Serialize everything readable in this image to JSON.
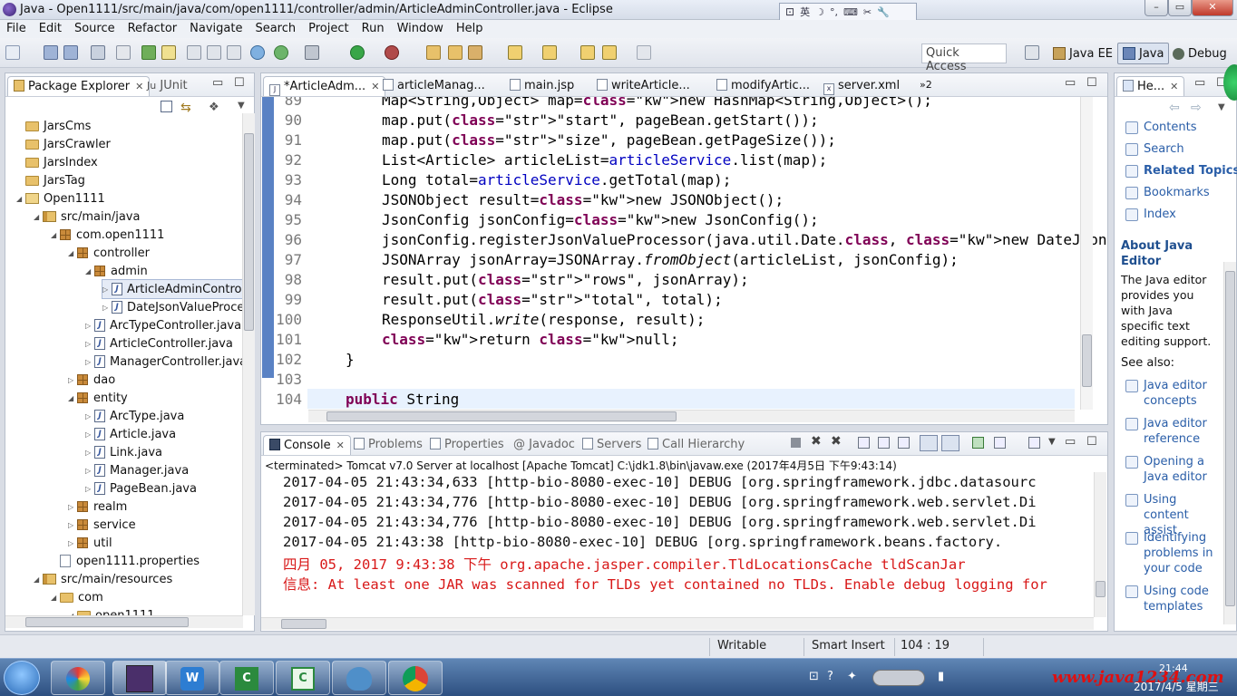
{
  "window": {
    "title": "Java - Open1111/src/main/java/com/open1111/controller/admin/ArticleAdminController.java - Eclipse",
    "ime_label": "英"
  },
  "menu": [
    "File",
    "Edit",
    "Source",
    "Refactor",
    "Navigate",
    "Search",
    "Project",
    "Run",
    "Window",
    "Help"
  ],
  "toolbar": {
    "quick_access": "Quick Access",
    "perspectives": [
      "Java EE",
      "Java",
      "Debug"
    ]
  },
  "package_explorer": {
    "tabs": [
      "Package Explorer",
      "JUnit"
    ],
    "items": [
      {
        "label": "JarsCms",
        "kind": "project"
      },
      {
        "label": "JarsCrawler",
        "kind": "project"
      },
      {
        "label": "JarsIndex",
        "kind": "project"
      },
      {
        "label": "JarsTag",
        "kind": "project"
      },
      {
        "label": "Open1111",
        "kind": "project"
      },
      {
        "label": "src/main/java",
        "kind": "source"
      },
      {
        "label": "com.open1111",
        "kind": "package"
      },
      {
        "label": "controller",
        "kind": "package"
      },
      {
        "label": "admin",
        "kind": "package"
      },
      {
        "label": "ArticleAdminControll",
        "kind": "java"
      },
      {
        "label": "DateJsonValueProce",
        "kind": "java"
      },
      {
        "label": "ArcTypeController.java",
        "kind": "java"
      },
      {
        "label": "ArticleController.java",
        "kind": "java"
      },
      {
        "label": "ManagerController.java",
        "kind": "java"
      },
      {
        "label": "dao",
        "kind": "package"
      },
      {
        "label": "entity",
        "kind": "package"
      },
      {
        "label": "ArcType.java",
        "kind": "java"
      },
      {
        "label": "Article.java",
        "kind": "java"
      },
      {
        "label": "Link.java",
        "kind": "java"
      },
      {
        "label": "Manager.java",
        "kind": "java"
      },
      {
        "label": "PageBean.java",
        "kind": "java"
      },
      {
        "label": "realm",
        "kind": "package"
      },
      {
        "label": "service",
        "kind": "package"
      },
      {
        "label": "util",
        "kind": "package"
      },
      {
        "label": "open1111.properties",
        "kind": "file"
      },
      {
        "label": "src/main/resources",
        "kind": "source"
      },
      {
        "label": "com",
        "kind": "folder"
      },
      {
        "label": "open1111",
        "kind": "folder"
      }
    ]
  },
  "editor": {
    "tabs": [
      "*ArticleAdm...",
      "articleManag...",
      "main.jsp",
      "writeArticle...",
      "modifyArtic...",
      "server.xml",
      "»2"
    ],
    "line_numbers": [
      "89",
      "90",
      "91",
      "92",
      "93",
      "94",
      "95",
      "96",
      "97",
      "98",
      "99",
      "100",
      "101",
      "102",
      "103",
      "104"
    ],
    "lines": [
      "Map<String,Object> map=new HashMap<String,Object>();",
      "map.put(\"start\", pageBean.getStart());",
      "map.put(\"size\", pageBean.getPageSize());",
      "List<Article> articleList=articleService.list(map);",
      "Long total=articleService.getTotal(map);",
      "JSONObject result=new JSONObject();",
      "JsonConfig jsonConfig=new JsonConfig();",
      "jsonConfig.registerJsonValueProcessor(java.util.Date.class, new DateJsonValue",
      "JSONArray jsonArray=JSONArray.fromObject(articleList, jsonConfig);",
      "result.put(\"rows\", jsonArray);",
      "result.put(\"total\", total);",
      "ResponseUtil.write(response, result);",
      "return null;",
      "}",
      "",
      "public String"
    ]
  },
  "console": {
    "tabs": [
      "Console",
      "Problems",
      "Properties",
      "Javadoc",
      "Servers",
      "Call Hierarchy"
    ],
    "header": "<terminated> Tomcat v7.0 Server at localhost [Apache Tomcat] C:\\jdk1.8\\bin\\javaw.exe (2017年4月5日 下午9:43:14)",
    "lines": [
      "2017-04-05 21:43:34,633 [http-bio-8080-exec-10] DEBUG [org.springframework.jdbc.datasourc",
      "2017-04-05 21:43:34,776 [http-bio-8080-exec-10] DEBUG [org.springframework.web.servlet.Di",
      "2017-04-05 21:43:34,776 [http-bio-8080-exec-10] DEBUG [org.springframework.web.servlet.Di",
      "2017-04-05 21:43:38 [http-bio-8080-exec-10] DEBUG [org.springframework.beans.factory.",
      "四月 05, 2017 9:43:38 下午 org.apache.jasper.compiler.TldLocationsCache tldScanJar",
      "信息: At least one JAR was scanned for TLDs yet contained no TLDs. Enable debug logging for"
    ]
  },
  "help": {
    "tab": "He...",
    "links": [
      "Contents",
      "Search",
      "Related Topics",
      "Bookmarks",
      "Index"
    ],
    "about_title": "About Java Editor",
    "about_text": "The Java editor provides you with Java specific text editing support.",
    "see_also": "See also:",
    "see_links": [
      "Java editor concepts",
      "Java editor reference",
      "Opening a Java editor",
      "Using content assist",
      "Identifying problems in your code",
      "Using code templates"
    ]
  },
  "status": {
    "mode": "Writable",
    "insert": "Smart Insert",
    "position": "104 : 19"
  },
  "taskbar": {
    "time": "21:44",
    "date": "2017/4/5 星期三",
    "watermark": "www.java1234.com"
  }
}
